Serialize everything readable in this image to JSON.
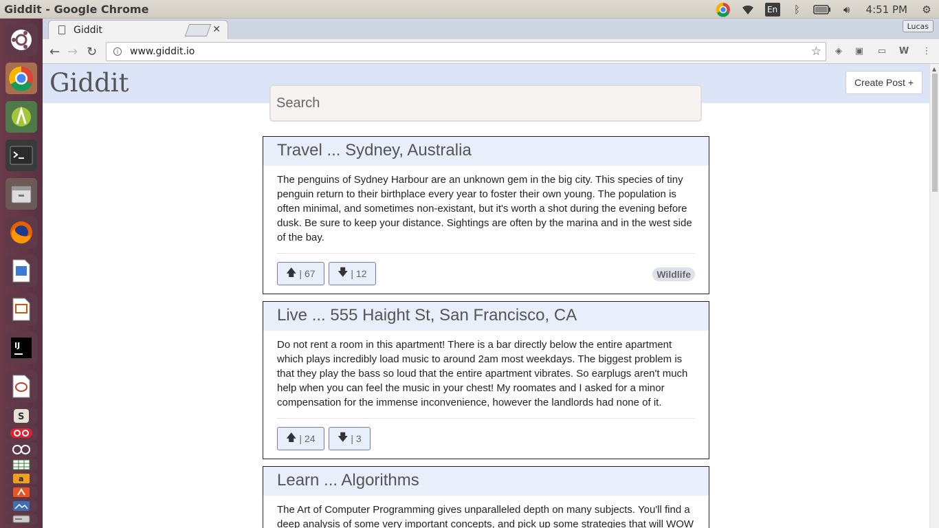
{
  "os": {
    "window_title": "Giddit - Google Chrome",
    "keyboard_layout": "En",
    "clock": "4:51 PM"
  },
  "chrome": {
    "tab_title": "Giddit",
    "profile": "Lucas",
    "url": "www.giddit.io"
  },
  "app": {
    "logo": "Giddit",
    "create_post_label": "Create Post +",
    "search_placeholder": "Search"
  },
  "posts": [
    {
      "title": "Travel ... Sydney, Australia",
      "body": "The penguins of Sydney Harbour are an unknown gem in the big city. This species of tiny penguin return to their birthplace every year to foster their own young. The population is often minimal, and sometimes non-existant, but it's worth a shot during the evening before dusk. Be sure to keep your distance. Sightings are often by the marina and in the west side of the bay.",
      "upvotes": "| 67",
      "downvotes": "| 12",
      "tag": "Wildlife"
    },
    {
      "title": "Live ... 555 Haight St, San Francisco, CA",
      "body": "Do not rent a room in this apartment! There is a bar directly below the entire apartment which plays incredibly load music to around 2am most weekdays. The biggest problem is that they play the bass so loud that the entire apartment vibrates. So earplugs aren't much help when you can feel the music in your chest! My roomates and I asked for a minor compensation for the immense inconvenience, however the landlords had none of it.",
      "upvotes": "| 24",
      "downvotes": "| 3",
      "tag": ""
    },
    {
      "title": "Learn ... Algorithms",
      "body": "The Art of Computer Programming gives unparalleled depth on many subjects. You'll find a deep analysis of some very important concepts, and pick up some strategies that will WOW"
    }
  ],
  "colors": {
    "header_band": "#dce5f7",
    "post_header": "#e9eefb",
    "launcher": "#5a3242"
  }
}
